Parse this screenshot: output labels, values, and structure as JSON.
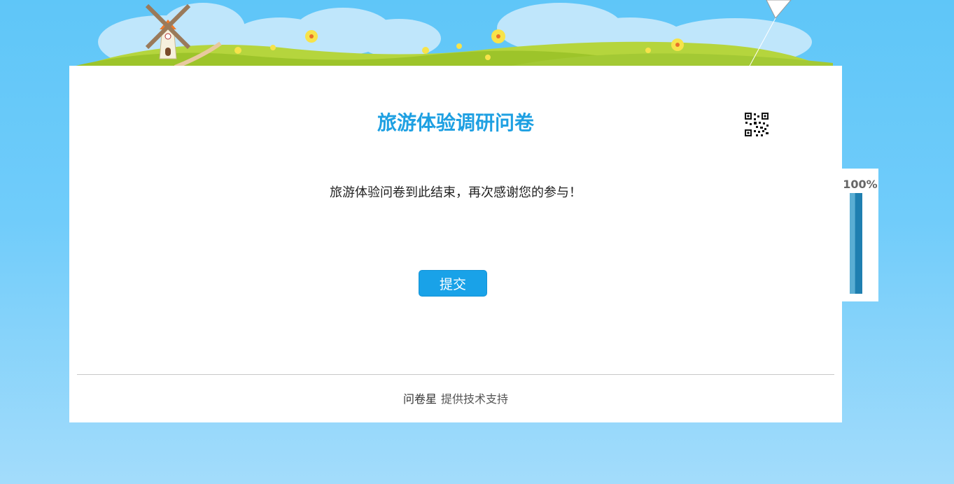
{
  "survey": {
    "title": "旅游体验调研问卷",
    "end_message": "旅游体验问卷到此结束，再次感谢您的参与！",
    "submit_label": "提交"
  },
  "footer": {
    "brand": "问卷星",
    "support_text": "提供技术支持"
  },
  "progress": {
    "label": "100%",
    "value": 1.0
  },
  "colors": {
    "accent": "#1ea0e2",
    "button": "#19a2e8",
    "sky": "#5fc6f8",
    "grass": "#a8cf3a"
  },
  "icons": {
    "qr": "qr-code-icon",
    "windmill": "windmill-icon",
    "kite": "kite-icon"
  }
}
